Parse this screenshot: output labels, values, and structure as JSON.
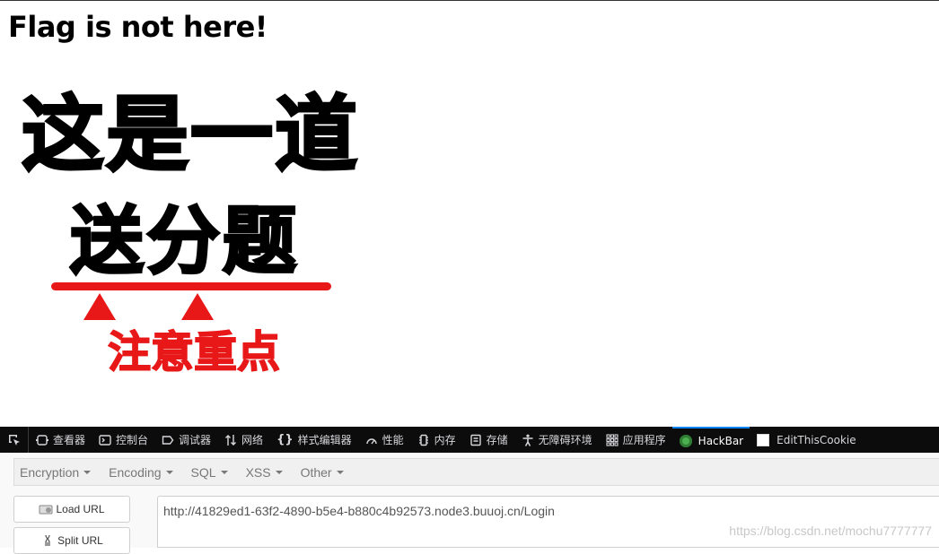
{
  "page": {
    "heading": "Flag is not here!",
    "meme": {
      "line1": "这是一道",
      "line2": "送分题",
      "line3": "注意重点",
      "accent_color": "#e81818"
    }
  },
  "devtools": {
    "tabs": [
      {
        "label": "查看器",
        "icon": "inspector-icon"
      },
      {
        "label": "控制台",
        "icon": "console-icon"
      },
      {
        "label": "调试器",
        "icon": "debugger-icon"
      },
      {
        "label": "网络",
        "icon": "network-icon"
      },
      {
        "label": "样式编辑器",
        "icon": "style-editor-icon"
      },
      {
        "label": "性能",
        "icon": "performance-icon"
      },
      {
        "label": "内存",
        "icon": "memory-icon"
      },
      {
        "label": "存储",
        "icon": "storage-icon"
      },
      {
        "label": "无障碍环境",
        "icon": "accessibility-icon"
      },
      {
        "label": "应用程序",
        "icon": "application-icon"
      },
      {
        "label": "HackBar",
        "icon": "hackbar-icon",
        "active": true
      },
      {
        "label": "EditThisCookie",
        "icon": "cookie-icon"
      }
    ],
    "active_color": "#0a84ff"
  },
  "hackbar": {
    "menu": [
      "Encryption",
      "Encoding",
      "SQL",
      "XSS",
      "Other"
    ],
    "load_url_label": "Load URL",
    "split_url_label": "Split URL",
    "url_value": "http://41829ed1-63f2-4890-b5e4-b880c4b92573.node3.buuoj.cn/Login"
  },
  "watermark": "https://blog.csdn.net/mochu7777777"
}
